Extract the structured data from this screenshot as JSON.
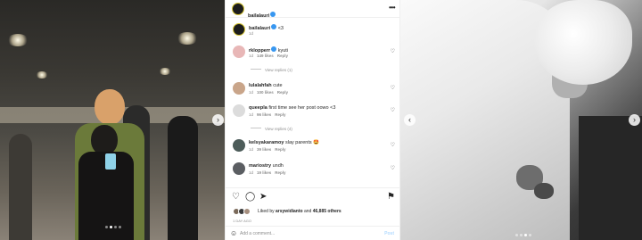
{
  "post": {
    "username": "bailalauri",
    "caption_author": "bailalauri",
    "caption": "<3",
    "caption_time": "1d"
  },
  "comments": [
    {
      "username": "rklopperr",
      "text": "kyuti",
      "time": "1d",
      "likes": "149 likes",
      "reply": "Reply",
      "view_replies": "View replies (1)",
      "avatar_color": "#e8b7b7"
    },
    {
      "username": "lulalahfah",
      "text": "cute",
      "time": "1d",
      "likes": "100 likes",
      "reply": "Reply",
      "view_replies": "",
      "avatar_color": "#c9a58a"
    },
    {
      "username": "queepla",
      "text": "first time see her post oowo <3",
      "time": "1d",
      "likes": "96 likes",
      "reply": "Reply",
      "view_replies": "View replies (4)",
      "avatar_color": "#dcdcdc"
    },
    {
      "username": "kelsyakaramoy",
      "text": "slay parents 🤩",
      "time": "1d",
      "likes": "39 likes",
      "reply": "Reply",
      "view_replies": "",
      "avatar_color": "#4d5c5a"
    },
    {
      "username": "mariostry",
      "text": "undh",
      "time": "1d",
      "likes": "19 likes",
      "reply": "Reply",
      "view_replies": "",
      "avatar_color": "#5b5e62"
    }
  ],
  "likes": {
    "prefix": "Liked by",
    "liker": "arsywidianto",
    "conjunction": "and",
    "others": "46,885 others"
  },
  "time_ago": "1 DAY AGO",
  "add_comment": {
    "placeholder": "Add a comment...",
    "post_label": "Post"
  },
  "icons": {
    "more": "more-options-icon",
    "heart": "heart-icon",
    "comment": "comment-icon",
    "share": "share-icon",
    "save": "bookmark-icon",
    "emoji": "emoji-icon"
  },
  "carousel": {
    "left_photo_active_dot": 2,
    "right_photo_active_dot": 3,
    "dot_count": 4
  }
}
